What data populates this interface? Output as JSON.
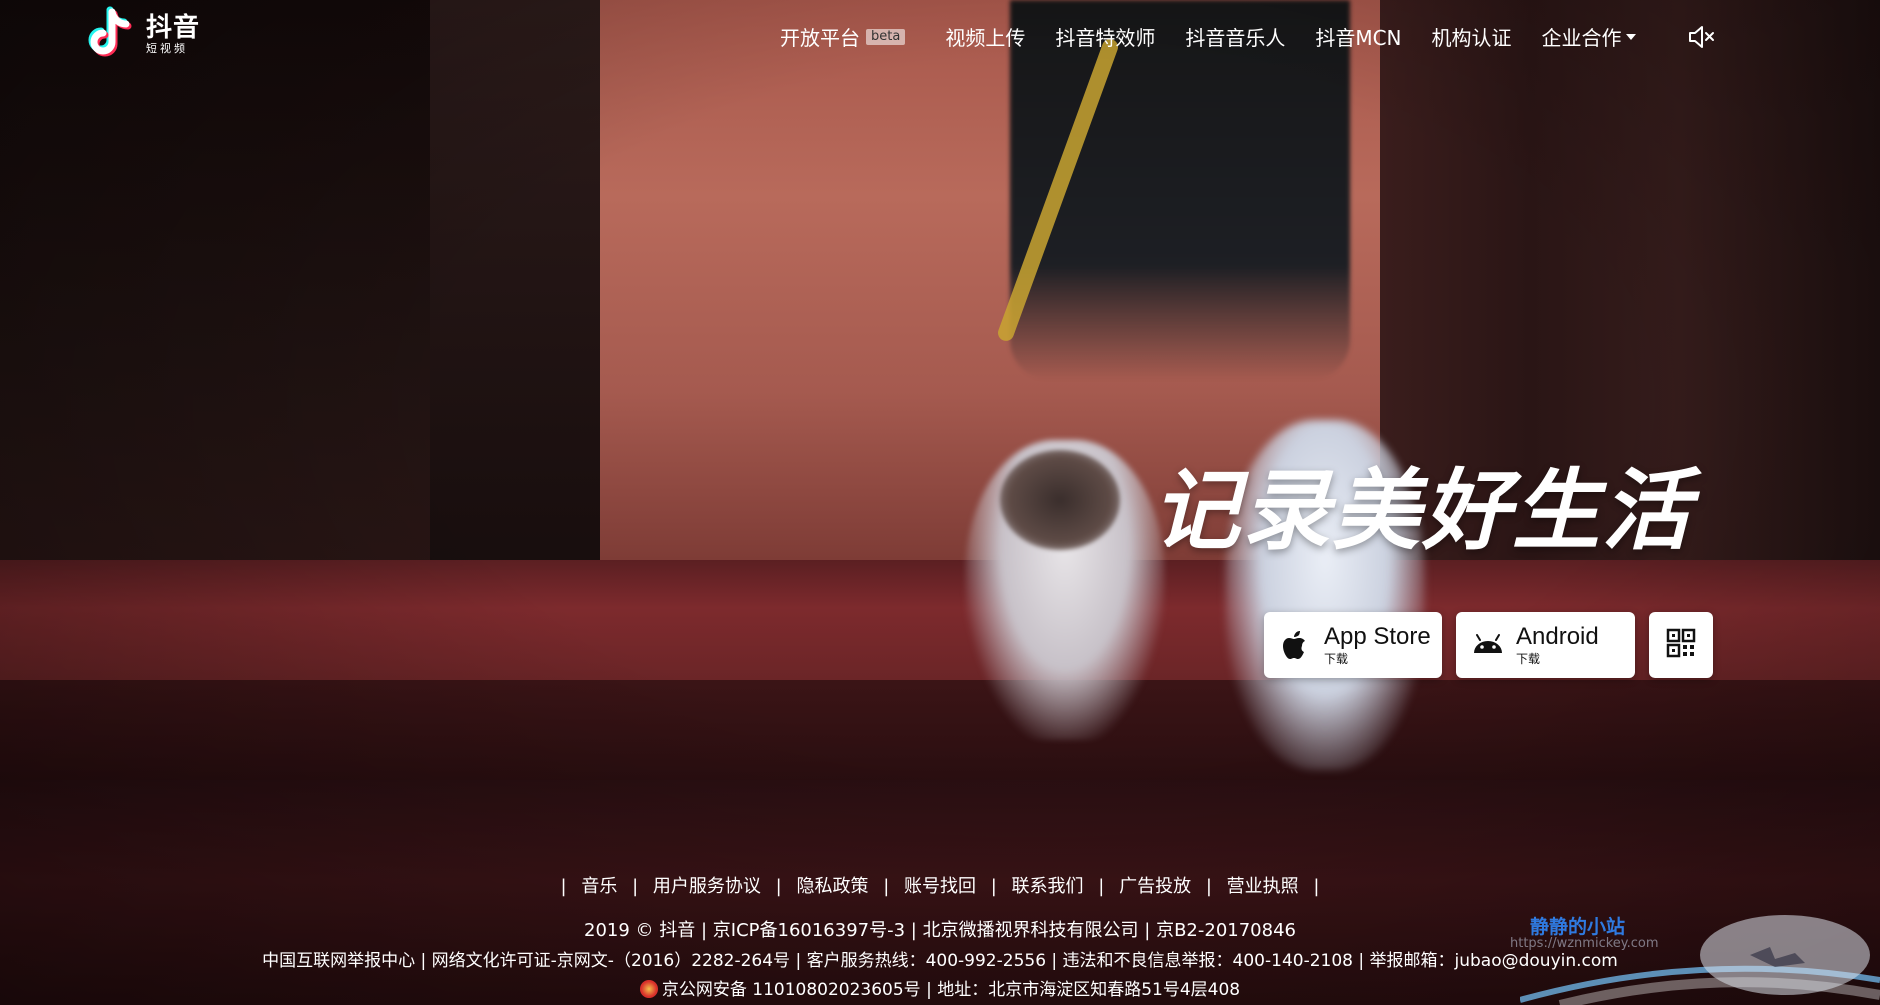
{
  "brand": {
    "name": "抖音",
    "sub": "短视频"
  },
  "nav": {
    "items": [
      {
        "label": "开放平台",
        "badge": "beta"
      },
      {
        "label": "视频上传"
      },
      {
        "label": "抖音特效师"
      },
      {
        "label": "抖音音乐人"
      },
      {
        "label": "抖音MCN"
      },
      {
        "label": "机构认证"
      },
      {
        "label": "企业合作",
        "has_dropdown": true
      }
    ],
    "mute_icon": "speaker-muted-icon"
  },
  "hero": {
    "slogan": "记录美好生活",
    "downloads": [
      {
        "title": "App Store",
        "sub": "下载",
        "icon": "apple-icon"
      },
      {
        "title": "Android",
        "sub": "下载",
        "icon": "android-icon"
      }
    ],
    "qr_icon": "qr-code-icon"
  },
  "footer": {
    "links": [
      "音乐",
      "用户服务协议",
      "隐私政策",
      "账号找回",
      "联系我们",
      "广告投放",
      "营业执照"
    ],
    "line1": "2019 © 抖音 | 京ICP备16016397号-3 | 北京微播视界科技有限公司 | 京B2-20170846",
    "line2": "中国互联网举报中心 | 网络文化许可证-京网文-（2016）2282-264号 | 客户服务热线：400-992-2556 | 违法和不良信息举报：400-140-2108 | 举报邮箱：jubao@douyin.com",
    "line3": "京公网安备 11010802023605号 | 地址：北京市海淀区知春路51号4层408"
  },
  "watermark": {
    "text": "静静的小站",
    "url": "https://wznmickey.com"
  }
}
